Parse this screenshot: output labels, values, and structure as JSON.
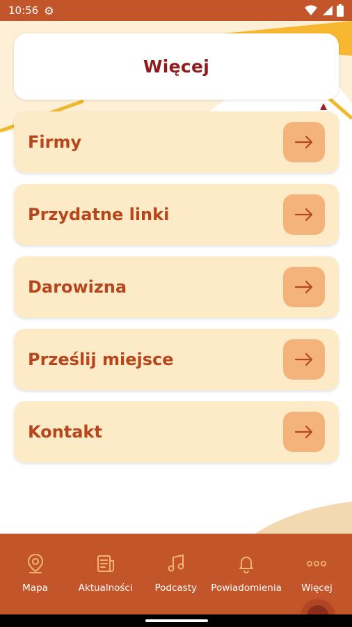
{
  "status_bar": {
    "time": "10:56"
  },
  "header": {
    "title": "Więcej"
  },
  "menu": [
    {
      "label": "Firmy"
    },
    {
      "label": "Przydatne linki"
    },
    {
      "label": "Darowizna"
    },
    {
      "label": "Prześlij miejsce"
    },
    {
      "label": "Kontakt"
    }
  ],
  "bottom_nav": [
    {
      "label": "Mapa",
      "icon": "map-pin-icon"
    },
    {
      "label": "Aktualności",
      "icon": "newspaper-icon"
    },
    {
      "label": "Podcasty",
      "icon": "music-note-icon"
    },
    {
      "label": "Powiadomienia",
      "icon": "bell-icon"
    },
    {
      "label": "Więcej",
      "icon": "more-dots-icon"
    }
  ],
  "colors": {
    "status_bar": "#c2562a",
    "menu_card": "#fdebc7",
    "menu_text": "#b8461c",
    "arrow_button": "#f5b37c",
    "header_title": "#8d1c1c",
    "nav_background": "#c2562a"
  }
}
